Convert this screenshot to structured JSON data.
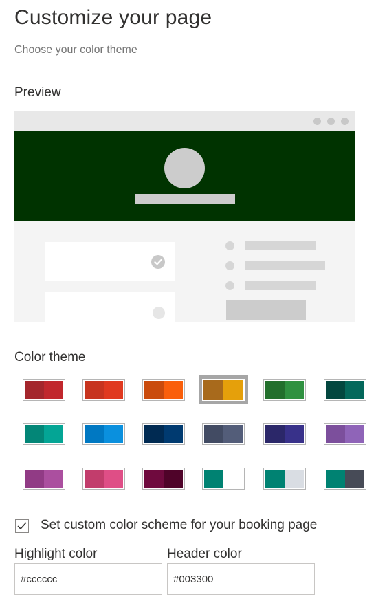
{
  "header": {
    "title": "Customize your page",
    "subtitle": "Choose your color theme"
  },
  "preview": {
    "label": "Preview",
    "header_color": "#003300",
    "highlight_color": "#cccccc"
  },
  "theme": {
    "label": "Color theme",
    "selected_index": 3,
    "swatches": [
      {
        "name": "swatch-dark-red",
        "colors": [
          "#a4262c",
          "#c1272d"
        ]
      },
      {
        "name": "swatch-red",
        "colors": [
          "#c7341f",
          "#e0391f"
        ]
      },
      {
        "name": "swatch-orange",
        "colors": [
          "#ca4b0c",
          "#fa5f0b"
        ]
      },
      {
        "name": "swatch-gold",
        "colors": [
          "#a86a1c",
          "#e5a00b"
        ]
      },
      {
        "name": "swatch-green",
        "colors": [
          "#226f2c",
          "#2f9140"
        ]
      },
      {
        "name": "swatch-dark-teal",
        "colors": [
          "#03473f",
          "#04685b"
        ]
      },
      {
        "name": "swatch-teal",
        "colors": [
          "#038677",
          "#04a595"
        ]
      },
      {
        "name": "swatch-blue",
        "colors": [
          "#0078c2",
          "#0a90de"
        ]
      },
      {
        "name": "swatch-navy",
        "colors": [
          "#002a52",
          "#003a70"
        ]
      },
      {
        "name": "swatch-slate",
        "colors": [
          "#424b63",
          "#535d79"
        ]
      },
      {
        "name": "swatch-indigo",
        "colors": [
          "#2b2769",
          "#38318a"
        ]
      },
      {
        "name": "swatch-lavender",
        "colors": [
          "#7c4f9c",
          "#8f64b8"
        ]
      },
      {
        "name": "swatch-purple",
        "colors": [
          "#913b85",
          "#ab4f9f"
        ]
      },
      {
        "name": "swatch-pink",
        "colors": [
          "#c23d6c",
          "#df4e86"
        ]
      },
      {
        "name": "swatch-plum",
        "colors": [
          "#6f0a3e",
          "#4f0329"
        ]
      },
      {
        "name": "swatch-teal-white",
        "colors": [
          "#008272",
          "#ffffff"
        ]
      },
      {
        "name": "swatch-teal-lightgray",
        "colors": [
          "#008272",
          "#d9dde3"
        ]
      },
      {
        "name": "swatch-teal-charcoal",
        "colors": [
          "#008272",
          "#474b57"
        ]
      }
    ]
  },
  "custom": {
    "checkbox_checked": true,
    "checkbox_label": "Set custom color scheme for your booking page",
    "highlight_label": "Highlight color",
    "highlight_value": "#cccccc",
    "header_label": "Header color",
    "header_value": "#003300"
  }
}
